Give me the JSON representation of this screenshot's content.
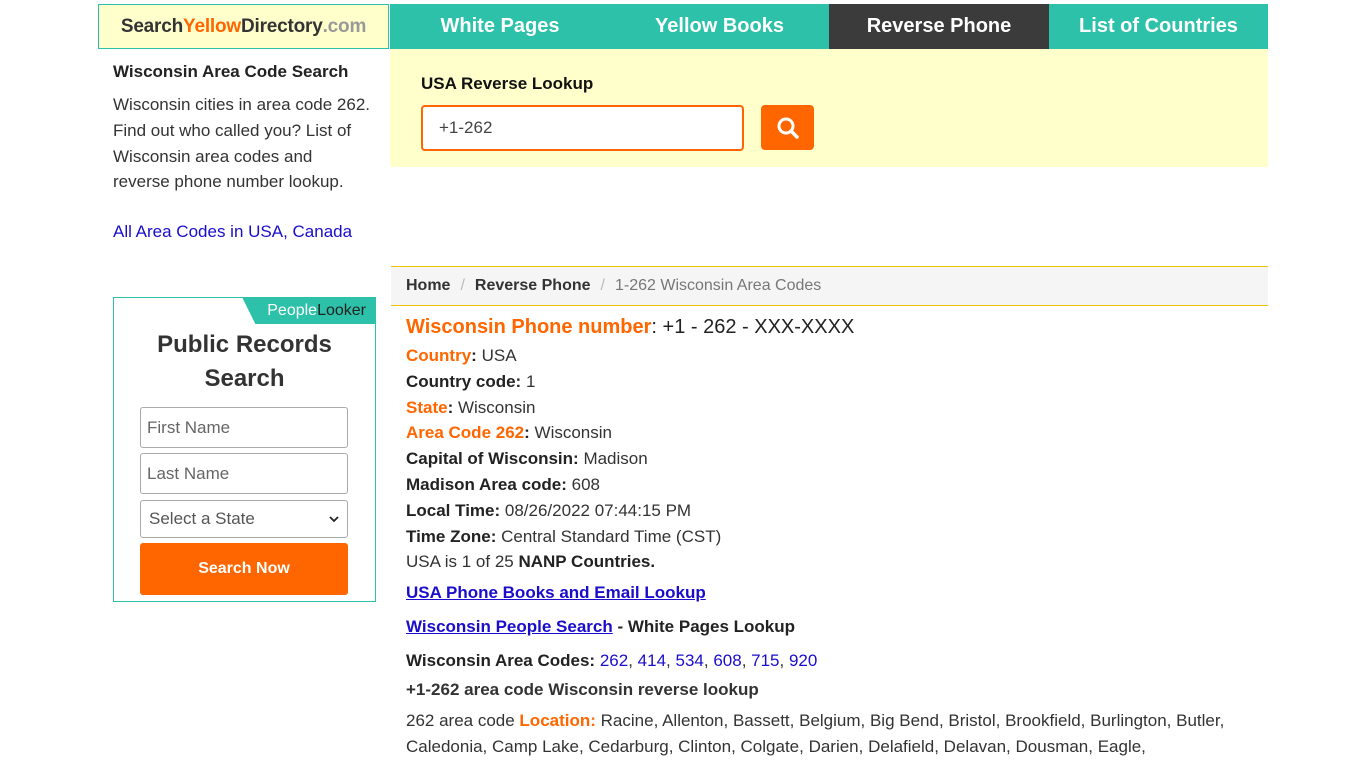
{
  "header": {
    "logo": {
      "part1": "Search",
      "part2": "Yellow",
      "part3": "Directory",
      "part4": ".com"
    },
    "nav": [
      {
        "label": "White Pages",
        "active": false
      },
      {
        "label": "Yellow Books",
        "active": false
      },
      {
        "label": "Reverse Phone",
        "active": true
      },
      {
        "label": "List of Countries",
        "active": false
      }
    ]
  },
  "sidebar": {
    "title": "Wisconsin Area Code Search",
    "description": "Wisconsin cities in area code 262. Find out who called you? List of Wisconsin area codes and reverse phone number lookup.",
    "all_codes_link": "All Area Codes in USA, Canada",
    "people_looker": {
      "people": "People",
      "looker": "Looker"
    },
    "public_records": {
      "title": "Public Records Search",
      "first_name_placeholder": "First Name",
      "last_name_placeholder": "Last Name",
      "state_select": "Select a State",
      "button": "Search Now"
    }
  },
  "lookup": {
    "title": "USA Reverse Lookup",
    "input_value": "+1-262",
    "search_icon": "search-icon"
  },
  "breadcrumb": {
    "home": "Home",
    "reverse_phone": "Reverse Phone",
    "current": "1-262 Wisconsin Area Codes"
  },
  "info": {
    "heading_label": "Wisconsin Phone number",
    "heading_value": ": +1 - 262 - XXX-XXXX",
    "country_label": "Country",
    "country": "USA",
    "country_code_label": "Country code:",
    "country_code": "1",
    "state_label": "State",
    "state": "Wisconsin",
    "area_code_label": "Area Code 262",
    "area_code_value": "Wisconsin",
    "capital_label": "Capital of Wisconsin:",
    "capital": "Madison",
    "madison_code_label": "Madison Area code:",
    "madison_code": "608",
    "local_time_label": "Local Time:",
    "local_time": "08/26/2022 07:44:15 PM",
    "time_zone_label": "Time Zone:",
    "time_zone": "Central Standard Time (CST)",
    "nanp_prefix": "USA is 1 of 25 ",
    "nanp_link": "NANP Countries",
    "nanp_suffix": ".",
    "phone_books_link": "USA Phone Books and Email Lookup",
    "people_search_link": "Wisconsin People Search",
    "people_search_suffix": " - White Pages Lookup",
    "area_codes_label": "Wisconsin Area Codes:",
    "area_codes": [
      "262",
      "414",
      "534",
      "608",
      "715",
      "920"
    ],
    "reverse_lookup_title": "+1-262 area code Wisconsin reverse lookup",
    "location_prefix": "262 area code ",
    "location_label": "Location:",
    "locations": "Racine, Allenton, Bassett, Belgium, Big Bend, Bristol, Brookfield, Burlington, Butler, Caledonia, Camp Lake, Cedarburg, Clinton, Colgate, Darien, Delafield, Delavan, Dousman, Eagle,"
  },
  "colors": {
    "teal": "#2cc1a8",
    "orange": "#ff6600",
    "dark": "#3b3b3b",
    "cream": "#ffffcc",
    "link": "#1a0dcc"
  }
}
